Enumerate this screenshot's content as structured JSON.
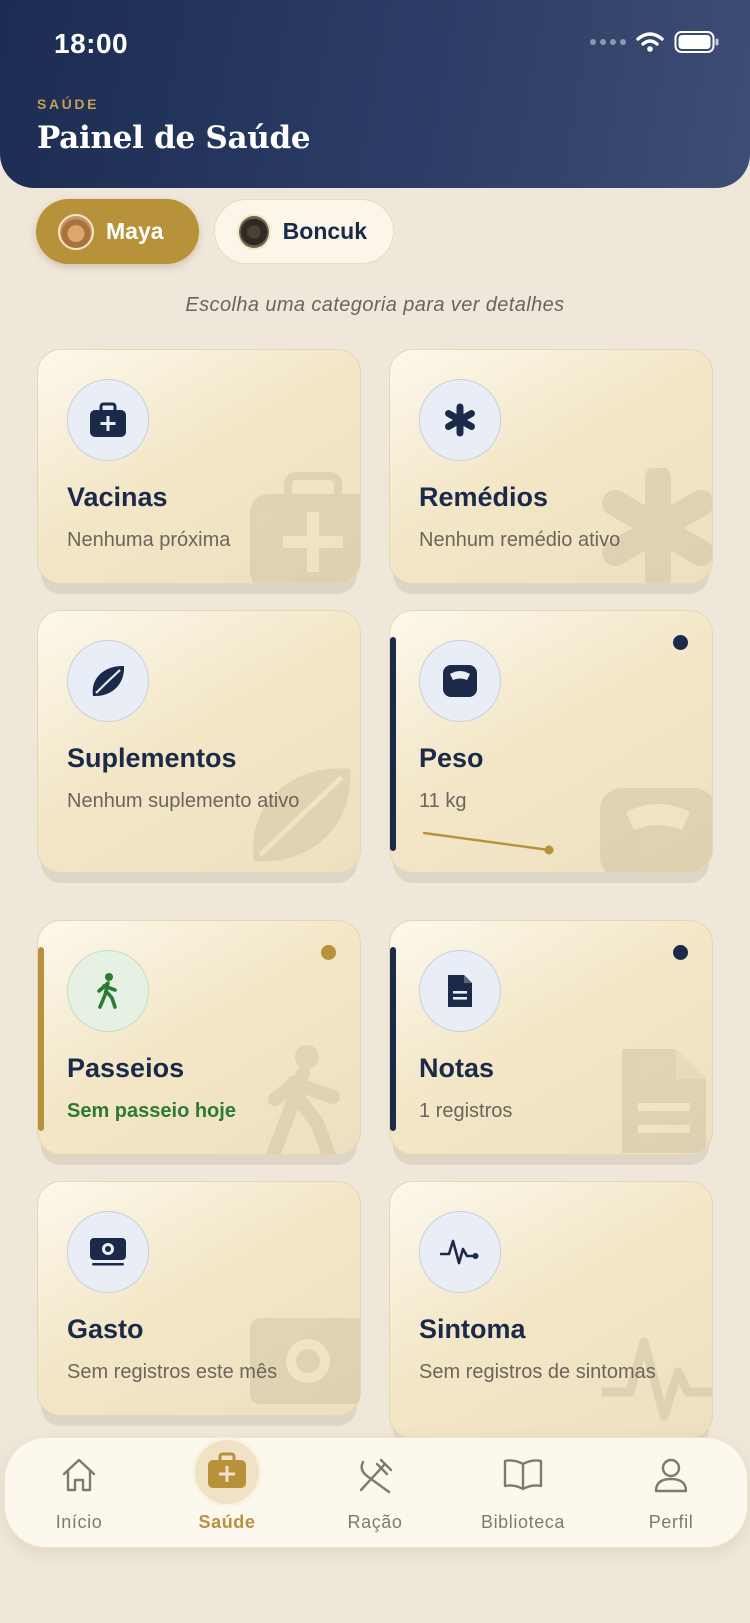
{
  "status_bar": {
    "time": "18:00"
  },
  "header": {
    "kicker": "SAÚDE",
    "title": "Painel de Saúde"
  },
  "pets": [
    {
      "name": "Maya",
      "selected": true
    },
    {
      "name": "Boncuk",
      "selected": false
    }
  ],
  "subtitle": "Escolha uma categoria para ver detalhes",
  "cards": {
    "vacinas": {
      "title": "Vacinas",
      "subtitle": "Nenhuma próxima",
      "icon": "medkit-icon"
    },
    "remedios": {
      "title": "Remédios",
      "subtitle": "Nenhum remédio ativo",
      "icon": "asterisk-icon"
    },
    "suplementos": {
      "title": "Suplementos",
      "subtitle": "Nenhum suplemento ativo",
      "icon": "leaf-icon"
    },
    "peso": {
      "title": "Peso",
      "subtitle": "11 kg",
      "icon": "scale-icon",
      "trend": [
        1.0,
        0.0
      ]
    },
    "passeios": {
      "title": "Passeios",
      "subtitle": "Sem passeio hoje",
      "icon": "walking-icon"
    },
    "notas": {
      "title": "Notas",
      "subtitle": "1 registros",
      "icon": "document-icon"
    },
    "gasto": {
      "title": "Gasto",
      "subtitle": "Sem registros este mês",
      "icon": "money-icon"
    },
    "sintoma": {
      "title": "Sintoma",
      "subtitle": "Sem registros de sintomas",
      "icon": "pulse-icon"
    }
  },
  "colors": {
    "navy": "#1c2a4a",
    "gold": "#b8923b",
    "green": "#2d7a34",
    "card_bg": "#f3e7c8"
  },
  "nav": [
    {
      "label": "Início",
      "icon": "home-icon",
      "active": false
    },
    {
      "label": "Saúde",
      "icon": "medkit-icon",
      "active": true
    },
    {
      "label": "Ração",
      "icon": "utensils-icon",
      "active": false
    },
    {
      "label": "Biblioteca",
      "icon": "book-icon",
      "active": false
    },
    {
      "label": "Perfil",
      "icon": "user-icon",
      "active": false
    }
  ]
}
